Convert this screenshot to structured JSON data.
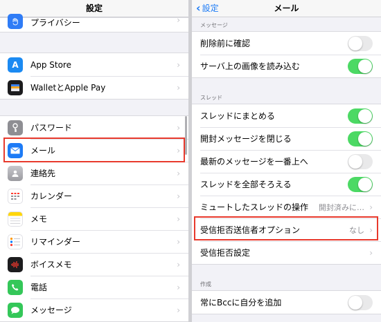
{
  "left": {
    "title": "設定",
    "group1": [
      {
        "label": "プライバシー",
        "icon": "hand-icon",
        "color": "#2f7cf6"
      }
    ],
    "group2": [
      {
        "label": "App Store",
        "icon": "app-store-icon",
        "color": "#1b8af2"
      },
      {
        "label": "WalletとApple Pay",
        "icon": "wallet-icon",
        "color": "#1c1c1e"
      }
    ],
    "group3": [
      {
        "label": "パスワード",
        "icon": "key-icon",
        "color": "#8e8e93"
      },
      {
        "label": "メール",
        "icon": "mail-icon",
        "color": "#1d7bf6",
        "highlighted": true
      },
      {
        "label": "連絡先",
        "icon": "contacts-icon",
        "color": "#9b9ba0"
      },
      {
        "label": "カレンダー",
        "icon": "calendar-icon",
        "color": "#ffffff"
      },
      {
        "label": "メモ",
        "icon": "notes-icon",
        "color": "#ffd60a"
      },
      {
        "label": "リマインダー",
        "icon": "reminders-icon",
        "color": "#ffffff"
      },
      {
        "label": "ボイスメモ",
        "icon": "voice-memo-icon",
        "color": "#1c1c1e"
      },
      {
        "label": "電話",
        "icon": "phone-icon",
        "color": "#34c759"
      },
      {
        "label": "メッセージ",
        "icon": "messages-icon",
        "color": "#34c759"
      }
    ]
  },
  "right": {
    "back_label": "設定",
    "title": "メール",
    "section_messages": "メッセージ",
    "messages_rows": [
      {
        "label": "削除前に確認",
        "toggle": false
      },
      {
        "label": "サーバ上の画像を読み込む",
        "toggle": true
      }
    ],
    "section_threads": "スレッド",
    "thread_rows": [
      {
        "label": "スレッドにまとめる",
        "toggle": true
      },
      {
        "label": "開封メッセージを閉じる",
        "toggle": true
      },
      {
        "label": "最新のメッセージを一番上へ",
        "toggle": false
      },
      {
        "label": "スレッドを全部そろえる",
        "toggle": true
      },
      {
        "label": "ミュートしたスレッドの操作",
        "value": "開封済みに…"
      },
      {
        "label": "受信拒否送信者オプション",
        "value": "なし",
        "highlighted": true
      },
      {
        "label": "受信拒否設定",
        "value": ""
      }
    ],
    "section_compose": "作成",
    "compose_rows": [
      {
        "label": "常にBccに自分を追加",
        "toggle": false
      }
    ]
  },
  "colors": {
    "accent": "#1d7bf6",
    "toggle_on": "#4cd964",
    "highlight": "#e8392c"
  }
}
